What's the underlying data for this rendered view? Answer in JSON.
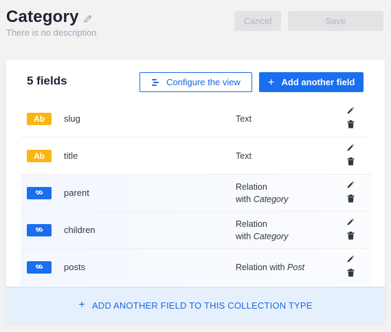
{
  "header": {
    "title": "Category",
    "description": "There is no description",
    "cancel_label": "Cancel",
    "save_label": "Save"
  },
  "card": {
    "fields_count": "5 fields",
    "configure_label": "Configure the view",
    "add_field_label": "Add another field",
    "footer_label": "ADD ANOTHER FIELD TO THIS COLLECTION TYPE",
    "footer_plus": "+"
  },
  "fields": [
    {
      "badge": "Ab",
      "kind": "text",
      "name": "slug",
      "type_line1": "Text",
      "type_prefix": "",
      "type_target": ""
    },
    {
      "badge": "Ab",
      "kind": "text",
      "name": "title",
      "type_line1": "Text",
      "type_prefix": "",
      "type_target": ""
    },
    {
      "badge": "",
      "kind": "relation",
      "name": "parent",
      "type_line1": "Relation",
      "type_prefix": "with ",
      "type_target": "Category"
    },
    {
      "badge": "",
      "kind": "relation",
      "name": "children",
      "type_line1": "Relation",
      "type_prefix": "with ",
      "type_target": "Category"
    },
    {
      "badge": "",
      "kind": "relation",
      "name": "posts",
      "type_line1": "Relation with ",
      "type_prefix": "",
      "type_target": "Post"
    }
  ],
  "colors": {
    "primary": "#1a6ff0",
    "text_badge": "#fab512",
    "disabled_button": "#e3e3e6",
    "footer_bg": "#e6f0fc"
  },
  "icons": {
    "title_edit": "pencil-icon",
    "configure": "layout-icon",
    "add": "plus-icon",
    "relation": "link-icon",
    "edit": "pencil-icon",
    "delete": "trash-icon"
  }
}
